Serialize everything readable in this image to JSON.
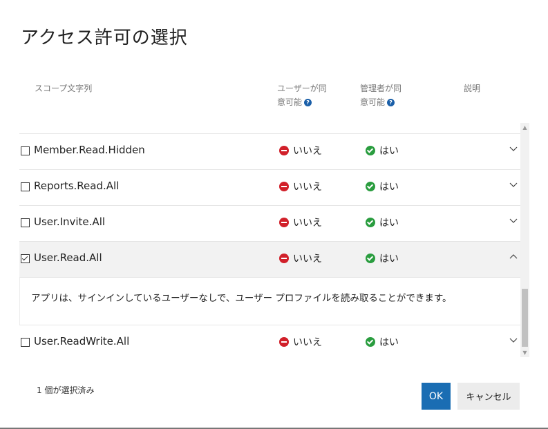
{
  "dialog": {
    "title": "アクセス許可の選択"
  },
  "columns": {
    "scope": "スコープ文字列",
    "user_consent_line1": "ユーザーが同",
    "user_consent_line2": "意可能",
    "admin_consent_line1": "管理者が同",
    "admin_consent_line2": "意可能",
    "description": "説明",
    "help_icon": "?"
  },
  "rows": [
    {
      "scope": "Member.Read.Hidden",
      "checked": false,
      "user_consent": "いいえ",
      "admin_consent": "はい",
      "expanded": false
    },
    {
      "scope": "Reports.Read.All",
      "checked": false,
      "user_consent": "いいえ",
      "admin_consent": "はい",
      "expanded": false
    },
    {
      "scope": "User.Invite.All",
      "checked": false,
      "user_consent": "いいえ",
      "admin_consent": "はい",
      "expanded": false
    },
    {
      "scope": "User.Read.All",
      "checked": true,
      "user_consent": "いいえ",
      "admin_consent": "はい",
      "expanded": true,
      "description": "アプリは、サインインしているユーザーなしで、ユーザー プロファイルを読み取ることができます。"
    },
    {
      "scope": "User.ReadWrite.All",
      "checked": false,
      "user_consent": "いいえ",
      "admin_consent": "はい",
      "expanded": false
    }
  ],
  "footer": {
    "selected_count": "1 個が選択済み",
    "ok_label": "OK",
    "cancel_label": "キャンセル"
  },
  "icons": {
    "no": "minus-circle-icon",
    "yes": "check-circle-icon",
    "expand": "chevron-down-icon",
    "collapse": "chevron-up-icon"
  },
  "colors": {
    "accent": "#1a6db3",
    "no": "#d1202a",
    "yes": "#2a9d3f"
  }
}
